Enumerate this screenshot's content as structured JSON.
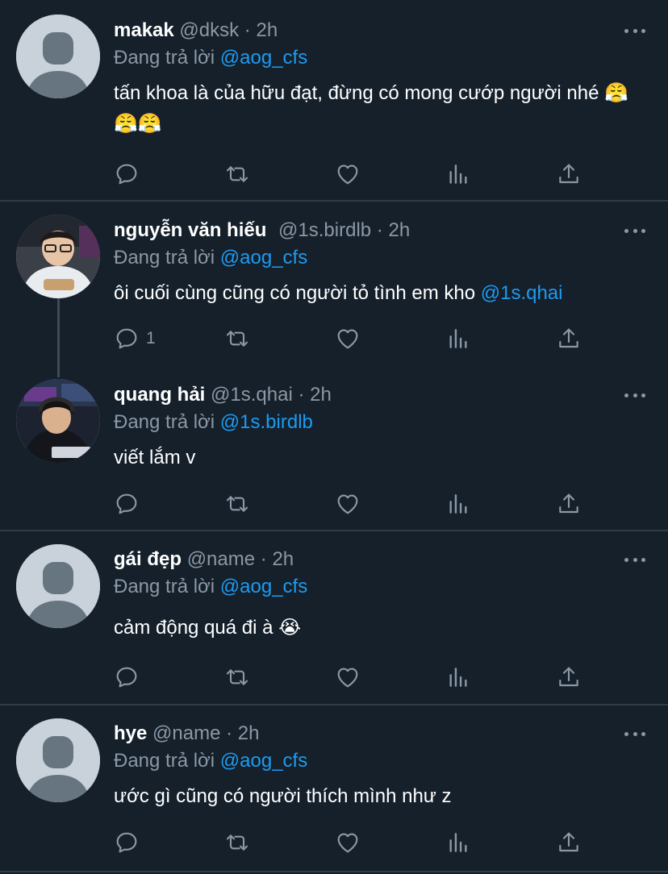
{
  "tweets": [
    {
      "name": "makak",
      "handle": "@dksk",
      "dot": "·",
      "time": "2h",
      "reply_prefix": "Đang trả lời",
      "reply_to": "@aog_cfs",
      "text": "tấn khoa là của hữu đạt, đừng có mong cướp người nhé 😤😤😤",
      "avatar": "default-avatar"
    },
    {
      "name": "nguyễn văn hiếu",
      "handle": "@1s.birdlb",
      "dot": "·",
      "time": "2h",
      "reply_prefix": "Đang trả lời",
      "reply_to": "@aog_cfs",
      "text_prefix": "ôi cuối cùng cũng có người tỏ tình em kho ",
      "text_mention": "@1s.qhai",
      "reply_count": "1",
      "avatar": "photo-avatar"
    },
    {
      "name": "quang hải",
      "handle": "@1s.qhai",
      "dot": "·",
      "time": "2h",
      "reply_prefix": "Đang trả lời",
      "reply_to": "@1s.birdlb",
      "text": "viết lắm v",
      "avatar": "photo-avatar"
    },
    {
      "name": "gái đẹp",
      "handle": "@name",
      "dot": "·",
      "time": "2h",
      "reply_prefix": "Đang trả lời",
      "reply_to": "@aog_cfs",
      "text": "cảm động quá đi à 😭",
      "avatar": "default-avatar"
    },
    {
      "name": "hye",
      "handle": "@name",
      "dot": "·",
      "time": "2h",
      "reply_prefix": "Đang trả lời",
      "reply_to": "@aog_cfs",
      "text": "ước gì cũng có người thích mình như z",
      "avatar": "default-avatar"
    }
  ],
  "action_icons": [
    "reply-icon",
    "retweet-icon",
    "like-icon",
    "analytics-icon",
    "share-icon"
  ],
  "colors": {
    "background": "#15202b",
    "divider": "#2f3b47",
    "muted": "#8b98a5",
    "mention": "#1d9bf0"
  }
}
